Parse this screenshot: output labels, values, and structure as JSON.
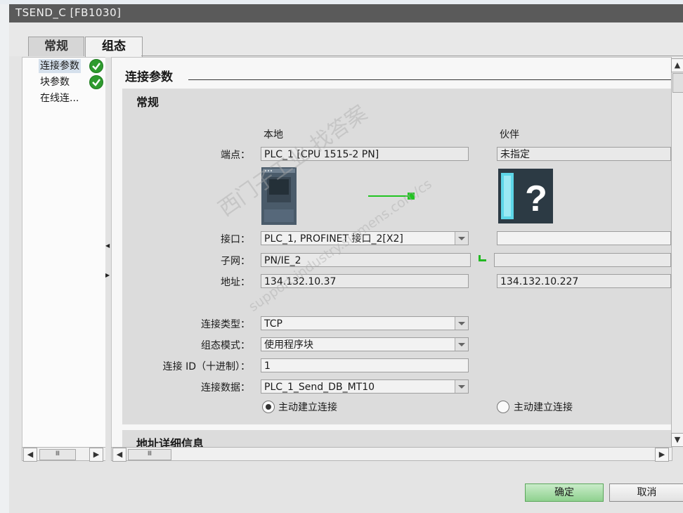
{
  "window": {
    "title": "TSEND_C [FB1030]"
  },
  "tabs": [
    {
      "label": "常规"
    },
    {
      "label": "组态"
    }
  ],
  "nav": {
    "items": [
      {
        "label": "连接参数"
      },
      {
        "label": "块参数"
      },
      {
        "label": "在线连..."
      }
    ]
  },
  "section": {
    "title": "连接参数"
  },
  "general": {
    "title": "常规",
    "local_header": "本地",
    "partner_header": "伙伴",
    "labels": {
      "endpoint": "端点：",
      "interface": "接口：",
      "subnet": "子网：",
      "address": "地址：",
      "conn_type": "连接类型：",
      "config_mode": "组态模式：",
      "conn_id": "连接 ID（十进制）：",
      "conn_data": "连接数据："
    },
    "local": {
      "endpoint": "PLC_1 [CPU 1515-2 PN]",
      "interface": "PLC_1, PROFINET 接口_2[X2]",
      "subnet": "PN/IE_2",
      "address": "134.132.10.37"
    },
    "partner": {
      "endpoint": "未指定",
      "interface": "",
      "subnet": "",
      "address": "134.132.10.227"
    },
    "conn_type": "TCP",
    "config_mode": "使用程序块",
    "conn_id": "1",
    "conn_data": "PLC_1_Send_DB_MT10",
    "active_local": "主动建立连接",
    "active_partner": "主动建立连接"
  },
  "address_details": {
    "title": "地址详细信息"
  },
  "buttons": {
    "ok": "确定",
    "cancel": "取消"
  },
  "watermark": {
    "line1": "西门子工业 找答案",
    "line2": "support.industry.siemens.com/cs"
  },
  "colors": {
    "ok_button": "#8fd18f",
    "check": "#2e9b2e",
    "title_bar": "#5a5a5a"
  }
}
